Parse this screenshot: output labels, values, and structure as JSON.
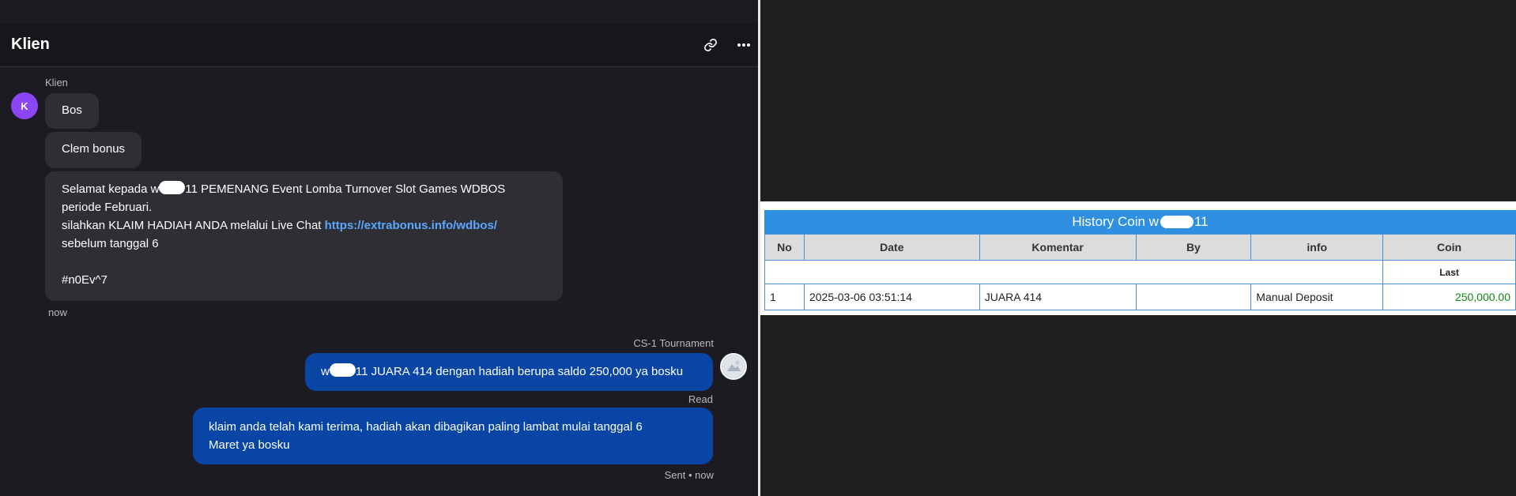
{
  "chat": {
    "title": "Klien",
    "header_icons": {
      "link": "link-icon",
      "more": "more-horizontal-icon"
    },
    "incoming": {
      "sender_name": "Klien",
      "avatar_letter": "K",
      "avatar_color": "#8b45f5",
      "messages": {
        "m1": "Bos",
        "m2": "Clem bonus",
        "m3": {
          "l1_before": "Selamat kepada w",
          "l1_after": "11 PEMENANG Event Lomba Turnover Slot Games WDBOS",
          "l2": "periode Februari.",
          "l3_text": "silahkan KLAIM HADIAH ANDA melalui Live Chat ",
          "l3_link": "https://extrabonus.info/wdbos/",
          "l4": "sebelum tanggal 6",
          "l6": "#n0Ev^7"
        }
      },
      "time": "now"
    },
    "outgoing": {
      "agent_name": "CS-1 Tournament",
      "m1_before": "w",
      "m1_after": "11 JUARA 414 dengan hadiah berupa saldo 250,000 ya bosku",
      "read_status": "Read",
      "m2_l1": "klaim anda telah kami terima, hadiah akan dibagikan paling lambat mulai tanggal 6",
      "m2_l2": "Maret ya bosku",
      "sent_status": "Sent • now",
      "bubble_color": "#0845a4"
    }
  },
  "history": {
    "title_before": "History Coin w",
    "title_after": "11",
    "title_color": "#2f8fe0",
    "columns": {
      "no": "No",
      "date": "Date",
      "komentar": "Komentar",
      "by": "By",
      "info": "info",
      "coin": "Coin"
    },
    "subheader_coin": "Last",
    "rows": [
      {
        "no": "1",
        "date": "2025-03-06 03:51:14",
        "komentar": "JUARA 414",
        "by": "",
        "info": "Manual Deposit",
        "coin": "250,000.00"
      }
    ]
  }
}
